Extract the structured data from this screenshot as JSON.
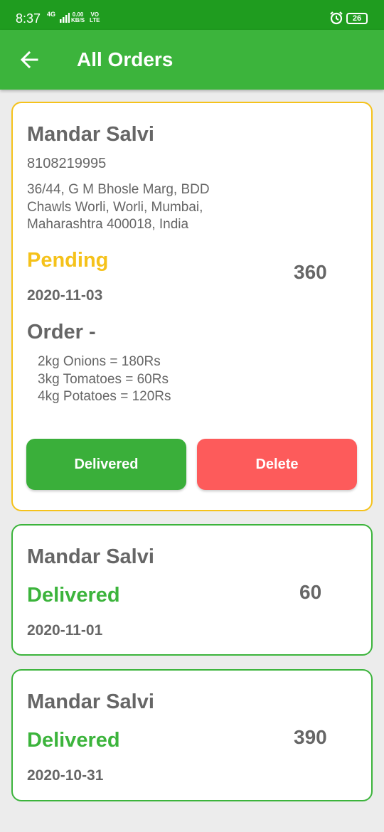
{
  "status_bar": {
    "time": "8:37",
    "network": "4G",
    "speed_value": "0.00",
    "speed_unit": "KB/S",
    "volte_top": "VO",
    "volte_bottom": "LTE",
    "battery": "26"
  },
  "app_bar": {
    "title": "All Orders",
    "back_icon": "arrow-left-icon"
  },
  "orders": [
    {
      "name": "Mandar Salvi",
      "phone": "8108219995",
      "address_lines": [
        "36/44, G M Bhosle Marg, BDD",
        "Chawls Worli, Worli, Mumbai,",
        "Maharashtra 400018, India"
      ],
      "status": "Pending",
      "amount": "360",
      "date": "2020-11-03",
      "order_heading": "Order -",
      "items": [
        "2kg Onions = 180Rs",
        "3kg Tomatoes = 60Rs",
        "4kg Potatoes = 120Rs"
      ],
      "delivered_label": "Delivered",
      "delete_label": "Delete"
    },
    {
      "name": "Mandar Salvi",
      "status": "Delivered",
      "amount": "60",
      "date": "2020-11-01"
    },
    {
      "name": "Mandar Salvi",
      "status": "Delivered",
      "amount": "390",
      "date": "2020-10-31"
    }
  ],
  "colors": {
    "status_bar": "#1f9c1f",
    "app_bar": "#3cb43c",
    "pending": "#f5c21b",
    "delivered": "#3cb43c",
    "delete": "#fd5b5b",
    "background": "#ececec"
  }
}
